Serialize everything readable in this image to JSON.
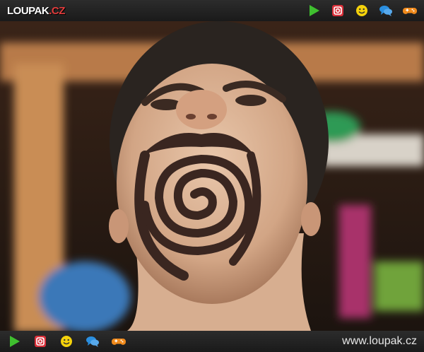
{
  "header": {
    "logo_main": "LOUPAK",
    "logo_suffix": ".CZ",
    "icons": [
      "play-icon",
      "instagram-icon",
      "smiley-icon",
      "chat-bubbles-icon",
      "gamepad-icon"
    ]
  },
  "footer": {
    "icons": [
      "play-icon",
      "instagram-icon",
      "smiley-icon",
      "chat-bubbles-icon",
      "gamepad-icon"
    ],
    "site_url": "www.loupak.cz"
  },
  "colors": {
    "bar_bg": "#1e1e1e",
    "play": "#3fbf2f",
    "instagram": "#d9303a",
    "smiley": "#f4d20b",
    "chat": "#2a8fe0",
    "gamepad": "#f08a1c",
    "logo_accent": "#e23c3c"
  }
}
